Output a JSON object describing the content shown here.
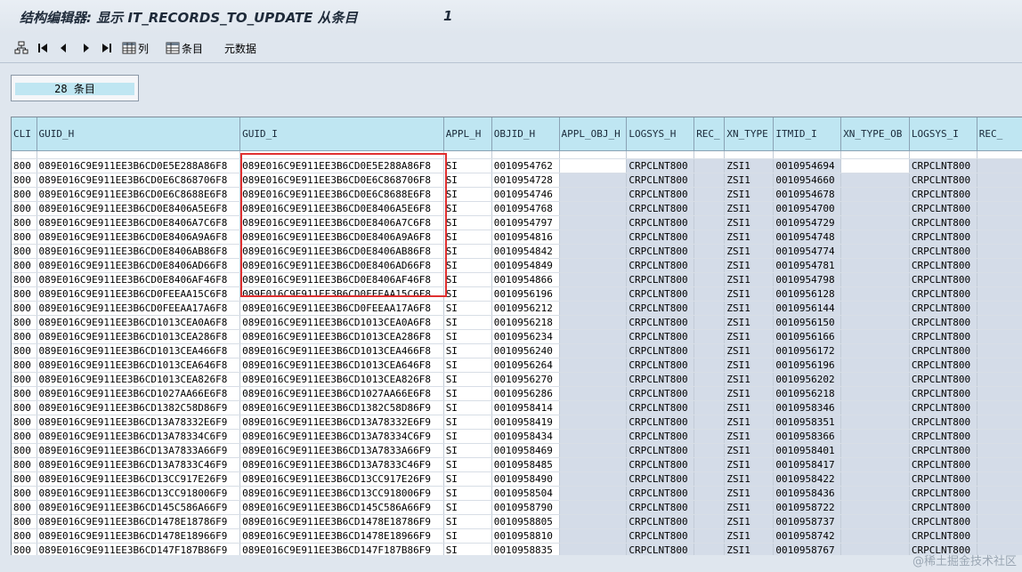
{
  "window": {
    "title": "结构编辑器: 显示 IT_RECORDS_TO_UPDATE 从条目",
    "entry_number": "1"
  },
  "toolbar": {
    "first_icon": "tree-icon",
    "columns_label": "列",
    "entries_label": "条目",
    "metadata_label": "元数据"
  },
  "count_box": {
    "text": "28 条目"
  },
  "columns": [
    "CLI",
    "GUID_H",
    "GUID_I",
    "APPL_H",
    "OBJID_H",
    "APPL_OBJ_H",
    "LOGSYS_H",
    "REC_",
    "XN_TYPE",
    "ITMID_I",
    "XN_TYPE_OB",
    "LOGSYS_I",
    "REC_"
  ],
  "rows": [
    [
      "800",
      "089E016C9E911EE3B6CD0E5E288A86F8",
      "089E016C9E911EE3B6CD0E5E288A86F8",
      "SI",
      "0010954762",
      "",
      "CRPCLNT800",
      "",
      "ZSI1",
      "0010954694",
      "",
      "CRPCLNT800",
      ""
    ],
    [
      "800",
      "089E016C9E911EE3B6CD0E6C868706F8",
      "089E016C9E911EE3B6CD0E6C868706F8",
      "SI",
      "0010954728",
      "",
      "CRPCLNT800",
      "",
      "ZSI1",
      "0010954660",
      "",
      "CRPCLNT800",
      ""
    ],
    [
      "800",
      "089E016C9E911EE3B6CD0E6C8688E6F8",
      "089E016C9E911EE3B6CD0E6C8688E6F8",
      "SI",
      "0010954746",
      "",
      "CRPCLNT800",
      "",
      "ZSI1",
      "0010954678",
      "",
      "CRPCLNT800",
      ""
    ],
    [
      "800",
      "089E016C9E911EE3B6CD0E8406A5E6F8",
      "089E016C9E911EE3B6CD0E8406A5E6F8",
      "SI",
      "0010954768",
      "",
      "CRPCLNT800",
      "",
      "ZSI1",
      "0010954700",
      "",
      "CRPCLNT800",
      ""
    ],
    [
      "800",
      "089E016C9E911EE3B6CD0E8406A7C6F8",
      "089E016C9E911EE3B6CD0E8406A7C6F8",
      "SI",
      "0010954797",
      "",
      "CRPCLNT800",
      "",
      "ZSI1",
      "0010954729",
      "",
      "CRPCLNT800",
      ""
    ],
    [
      "800",
      "089E016C9E911EE3B6CD0E8406A9A6F8",
      "089E016C9E911EE3B6CD0E8406A9A6F8",
      "SI",
      "0010954816",
      "",
      "CRPCLNT800",
      "",
      "ZSI1",
      "0010954748",
      "",
      "CRPCLNT800",
      ""
    ],
    [
      "800",
      "089E016C9E911EE3B6CD0E8406AB86F8",
      "089E016C9E911EE3B6CD0E8406AB86F8",
      "SI",
      "0010954842",
      "",
      "CRPCLNT800",
      "",
      "ZSI1",
      "0010954774",
      "",
      "CRPCLNT800",
      ""
    ],
    [
      "800",
      "089E016C9E911EE3B6CD0E8406AD66F8",
      "089E016C9E911EE3B6CD0E8406AD66F8",
      "SI",
      "0010954849",
      "",
      "CRPCLNT800",
      "",
      "ZSI1",
      "0010954781",
      "",
      "CRPCLNT800",
      ""
    ],
    [
      "800",
      "089E016C9E911EE3B6CD0E8406AF46F8",
      "089E016C9E911EE3B6CD0E8406AF46F8",
      "SI",
      "0010954866",
      "",
      "CRPCLNT800",
      "",
      "ZSI1",
      "0010954798",
      "",
      "CRPCLNT800",
      ""
    ],
    [
      "800",
      "089E016C9E911EE3B6CD0FEEAA15C6F8",
      "089E016C9E911EE3B6CD0FEEAA15C6F8",
      "SI",
      "0010956196",
      "",
      "CRPCLNT800",
      "",
      "ZSI1",
      "0010956128",
      "",
      "CRPCLNT800",
      ""
    ],
    [
      "800",
      "089E016C9E911EE3B6CD0FEEAA17A6F8",
      "089E016C9E911EE3B6CD0FEEAA17A6F8",
      "SI",
      "0010956212",
      "",
      "CRPCLNT800",
      "",
      "ZSI1",
      "0010956144",
      "",
      "CRPCLNT800",
      ""
    ],
    [
      "800",
      "089E016C9E911EE3B6CD1013CEA0A6F8",
      "089E016C9E911EE3B6CD1013CEA0A6F8",
      "SI",
      "0010956218",
      "",
      "CRPCLNT800",
      "",
      "ZSI1",
      "0010956150",
      "",
      "CRPCLNT800",
      ""
    ],
    [
      "800",
      "089E016C9E911EE3B6CD1013CEA286F8",
      "089E016C9E911EE3B6CD1013CEA286F8",
      "SI",
      "0010956234",
      "",
      "CRPCLNT800",
      "",
      "ZSI1",
      "0010956166",
      "",
      "CRPCLNT800",
      ""
    ],
    [
      "800",
      "089E016C9E911EE3B6CD1013CEA466F8",
      "089E016C9E911EE3B6CD1013CEA466F8",
      "SI",
      "0010956240",
      "",
      "CRPCLNT800",
      "",
      "ZSI1",
      "0010956172",
      "",
      "CRPCLNT800",
      ""
    ],
    [
      "800",
      "089E016C9E911EE3B6CD1013CEA646F8",
      "089E016C9E911EE3B6CD1013CEA646F8",
      "SI",
      "0010956264",
      "",
      "CRPCLNT800",
      "",
      "ZSI1",
      "0010956196",
      "",
      "CRPCLNT800",
      ""
    ],
    [
      "800",
      "089E016C9E911EE3B6CD1013CEA826F8",
      "089E016C9E911EE3B6CD1013CEA826F8",
      "SI",
      "0010956270",
      "",
      "CRPCLNT800",
      "",
      "ZSI1",
      "0010956202",
      "",
      "CRPCLNT800",
      ""
    ],
    [
      "800",
      "089E016C9E911EE3B6CD1027AA66E6F8",
      "089E016C9E911EE3B6CD1027AA66E6F8",
      "SI",
      "0010956286",
      "",
      "CRPCLNT800",
      "",
      "ZSI1",
      "0010956218",
      "",
      "CRPCLNT800",
      ""
    ],
    [
      "800",
      "089E016C9E911EE3B6CD1382C58D86F9",
      "089E016C9E911EE3B6CD1382C58D86F9",
      "SI",
      "0010958414",
      "",
      "CRPCLNT800",
      "",
      "ZSI1",
      "0010958346",
      "",
      "CRPCLNT800",
      ""
    ],
    [
      "800",
      "089E016C9E911EE3B6CD13A78332E6F9",
      "089E016C9E911EE3B6CD13A78332E6F9",
      "SI",
      "0010958419",
      "",
      "CRPCLNT800",
      "",
      "ZSI1",
      "0010958351",
      "",
      "CRPCLNT800",
      ""
    ],
    [
      "800",
      "089E016C9E911EE3B6CD13A78334C6F9",
      "089E016C9E911EE3B6CD13A78334C6F9",
      "SI",
      "0010958434",
      "",
      "CRPCLNT800",
      "",
      "ZSI1",
      "0010958366",
      "",
      "CRPCLNT800",
      ""
    ],
    [
      "800",
      "089E016C9E911EE3B6CD13A7833A66F9",
      "089E016C9E911EE3B6CD13A7833A66F9",
      "SI",
      "0010958469",
      "",
      "CRPCLNT800",
      "",
      "ZSI1",
      "0010958401",
      "",
      "CRPCLNT800",
      ""
    ],
    [
      "800",
      "089E016C9E911EE3B6CD13A7833C46F9",
      "089E016C9E911EE3B6CD13A7833C46F9",
      "SI",
      "0010958485",
      "",
      "CRPCLNT800",
      "",
      "ZSI1",
      "0010958417",
      "",
      "CRPCLNT800",
      ""
    ],
    [
      "800",
      "089E016C9E911EE3B6CD13CC917E26F9",
      "089E016C9E911EE3B6CD13CC917E26F9",
      "SI",
      "0010958490",
      "",
      "CRPCLNT800",
      "",
      "ZSI1",
      "0010958422",
      "",
      "CRPCLNT800",
      ""
    ],
    [
      "800",
      "089E016C9E911EE3B6CD13CC918006F9",
      "089E016C9E911EE3B6CD13CC918006F9",
      "SI",
      "0010958504",
      "",
      "CRPCLNT800",
      "",
      "ZSI1",
      "0010958436",
      "",
      "CRPCLNT800",
      ""
    ],
    [
      "800",
      "089E016C9E911EE3B6CD145C586A66F9",
      "089E016C9E911EE3B6CD145C586A66F9",
      "SI",
      "0010958790",
      "",
      "CRPCLNT800",
      "",
      "ZSI1",
      "0010958722",
      "",
      "CRPCLNT800",
      ""
    ],
    [
      "800",
      "089E016C9E911EE3B6CD1478E18786F9",
      "089E016C9E911EE3B6CD1478E18786F9",
      "SI",
      "0010958805",
      "",
      "CRPCLNT800",
      "",
      "ZSI1",
      "0010958737",
      "",
      "CRPCLNT800",
      ""
    ],
    [
      "800",
      "089E016C9E911EE3B6CD1478E18966F9",
      "089E016C9E911EE3B6CD1478E18966F9",
      "SI",
      "0010958810",
      "",
      "CRPCLNT800",
      "",
      "ZSI1",
      "0010958742",
      "",
      "CRPCLNT800",
      ""
    ],
    [
      "800",
      "089E016C9E911EE3B6CD147F187B86F9",
      "089E016C9E911EE3B6CD147F187B86F9",
      "SI",
      "0010958835",
      "",
      "CRPCLNT800",
      "",
      "ZSI1",
      "0010958767",
      "",
      "CRPCLNT800",
      ""
    ]
  ],
  "watermark": "@稀土掘金技术社区"
}
